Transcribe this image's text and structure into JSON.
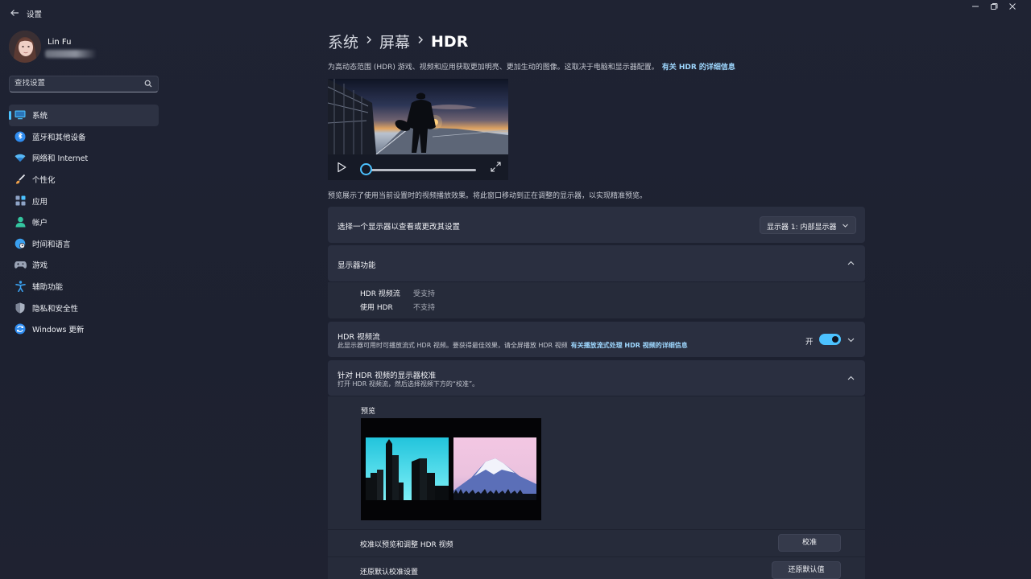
{
  "app": {
    "title": "设置"
  },
  "user": {
    "name": "Lin Fu"
  },
  "search": {
    "placeholder": "查找设置"
  },
  "nav": [
    {
      "label": "系统",
      "icon": "display-icon",
      "color": "#4cc2ff"
    },
    {
      "label": "蓝牙和其他设备",
      "icon": "bluetooth-icon",
      "color": "#2f8cf0"
    },
    {
      "label": "网络和 Internet",
      "icon": "wifi-icon",
      "color": "#57b7f5"
    },
    {
      "label": "个性化",
      "icon": "brush-icon",
      "color": "#f0a14a"
    },
    {
      "label": "应用",
      "icon": "apps-icon",
      "color": "#8fa4c7"
    },
    {
      "label": "帐户",
      "icon": "person-icon",
      "color": "#34c6a0"
    },
    {
      "label": "时间和语言",
      "icon": "globe-clock-icon",
      "color": "#3aa0f0"
    },
    {
      "label": "游戏",
      "icon": "gamepad-icon",
      "color": "#9aa3b5"
    },
    {
      "label": "辅助功能",
      "icon": "accessibility-icon",
      "color": "#3aa0f0"
    },
    {
      "label": "隐私和安全性",
      "icon": "shield-icon",
      "color": "#a9b1c0"
    },
    {
      "label": "Windows 更新",
      "icon": "update-icon",
      "color": "#2f8cf0"
    }
  ],
  "breadcrumb": {
    "part1": "系统",
    "part2": "屏幕",
    "current": "HDR"
  },
  "description": {
    "text": "为高动态范围 (HDR) 游戏、视频和应用获取更加明亮、更加生动的图像。这取决于电脑和显示器配置。",
    "link": "有关 HDR 的详细信息"
  },
  "video": {
    "progress": 0.0
  },
  "caption": "预览展示了使用当前设置时的视频播放效果。将此窗口移动到正在调整的显示器，以实现精准预览。",
  "display_select": {
    "label": "选择一个显示器以查看或更改其设置",
    "value": "显示器 1: 内部显示器"
  },
  "capabilities": {
    "title": "显示器功能",
    "rows": [
      {
        "key": "HDR 视频流",
        "value": "受支持"
      },
      {
        "key": "使用 HDR",
        "value": "不支持"
      }
    ]
  },
  "hdr_streaming": {
    "title": "HDR 视频流",
    "subtitle": "此显示器可用时可播放流式 HDR 视频。要获得最佳效果，请全屏播放 HDR 视频",
    "link": "有关播放流式处理 HDR 视频的详细信息",
    "toggle_label": "开",
    "on": true
  },
  "calibration": {
    "title": "针对 HDR 视频的显示器校准",
    "subtitle": "打开 HDR 视频流，然后选择视频下方的“校准”。",
    "preview_label": "预览",
    "calibrate_row": "校准以预览和调整 HDR 视频",
    "calibrate_button": "校准",
    "reset_row": "还原默认校准设置",
    "reset_button": "还原默认值"
  },
  "colors": {
    "accent": "#4cc2ff",
    "link": "#9fd8ff",
    "card": "#2a2f40",
    "background": "#1e2232"
  }
}
